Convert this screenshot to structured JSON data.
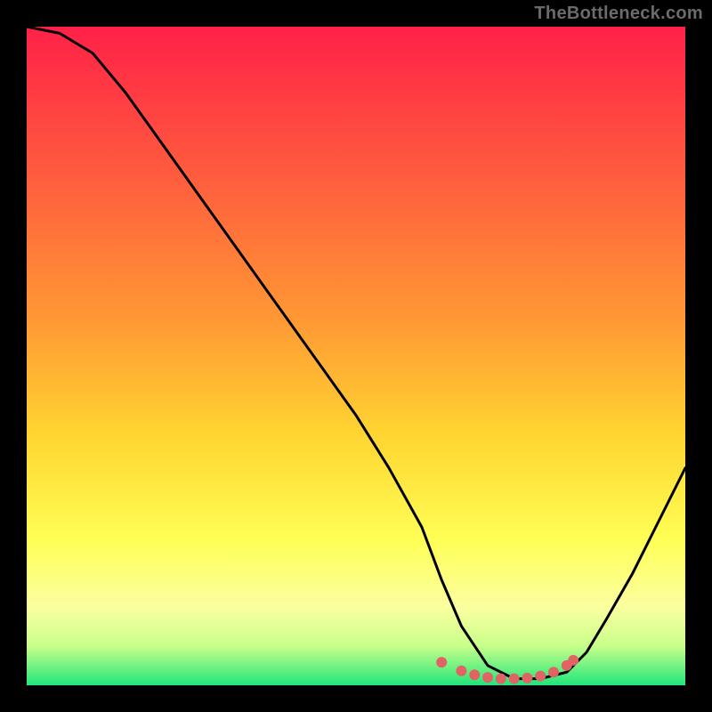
{
  "watermark": "TheBottleneck.com",
  "colors": {
    "bg_black": "#000000",
    "gradient_top": "#ff2148",
    "gradient_mid1": "#ff7a3a",
    "gradient_mid2": "#ffd531",
    "gradient_low1": "#ffff6a",
    "gradient_low2": "#eaff80",
    "gradient_bot": "#21e67a",
    "curve": "#000000",
    "dots": "#e06464"
  },
  "chart_data": {
    "type": "line",
    "title": "",
    "xlabel": "",
    "ylabel": "",
    "xlim": [
      0,
      100
    ],
    "ylim": [
      0,
      100
    ],
    "grid": false,
    "legend": false,
    "series": [
      {
        "name": "bottleneck-curve",
        "x": [
          0,
          5,
          10,
          15,
          20,
          25,
          30,
          35,
          40,
          45,
          50,
          55,
          60,
          63,
          66,
          70,
          74,
          78,
          82,
          85,
          88,
          92,
          96,
          100
        ],
        "values": [
          100,
          99,
          96,
          90,
          83,
          76,
          69,
          62,
          55,
          48,
          41,
          33,
          24,
          16,
          9,
          3,
          1,
          1,
          2,
          5,
          10,
          17,
          25,
          33
        ]
      }
    ],
    "highlight_dots": {
      "name": "optimal-zone-markers",
      "x": [
        63,
        66,
        68,
        70,
        72,
        74,
        76,
        78,
        80,
        82,
        83
      ],
      "values": [
        3.5,
        2.2,
        1.6,
        1.2,
        1.0,
        1.0,
        1.1,
        1.4,
        2.0,
        3.0,
        3.8
      ]
    }
  }
}
